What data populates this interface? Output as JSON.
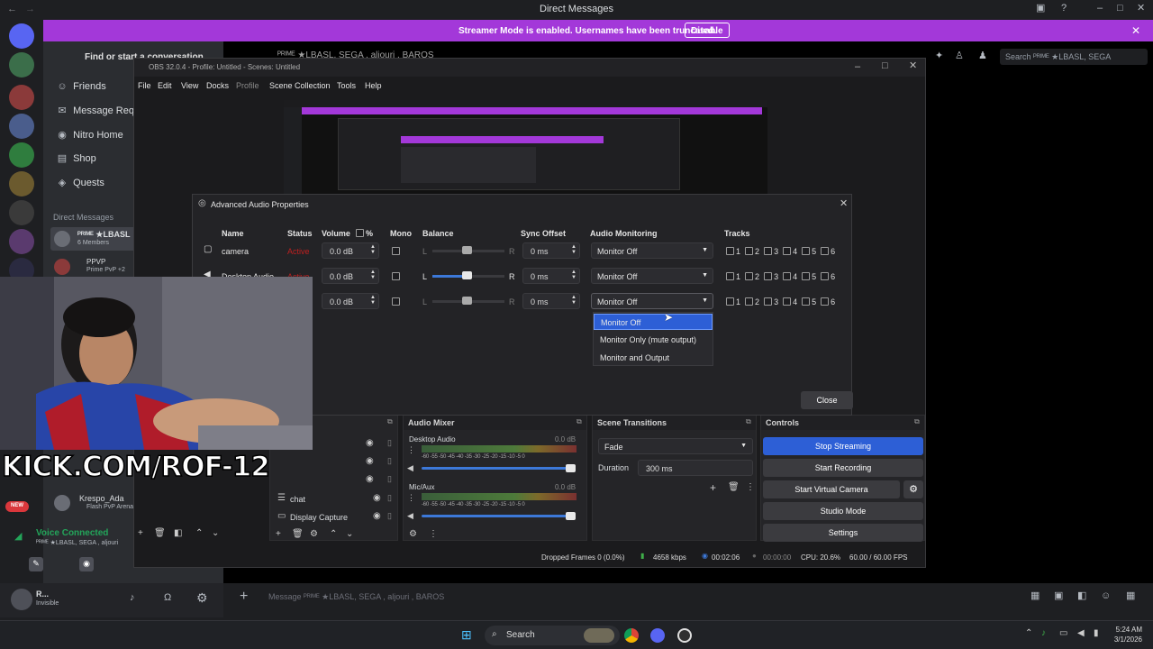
{
  "discord": {
    "window_title": "Direct Messages",
    "banner_text": "Streamer Mode is enabled. Usernames have been truncated.",
    "banner_button": "Disable",
    "find_placeholder": "Find or start a conversation",
    "nav": [
      "Friends",
      "Message Requests",
      "Nitro Home",
      "Shop",
      "Quests"
    ],
    "dm_header": "Direct Messages",
    "dm_items": [
      {
        "name": "ᴾᴿᴵᴹᴱ ★LBASL",
        "sub": "6 Members"
      },
      {
        "name": "PPVP",
        "sub": "Prime PvP +2"
      },
      {
        "name": "Krespo_Ada",
        "sub": "Flash PvP Arena"
      }
    ],
    "search_placeholder": "Search ᴾᴿᴵᴹᴱ ★LBASL, SEGA",
    "voice_status": "Voice Connected",
    "voice_channel": "ᴾᴿᴵᴹᴱ ★LBASL, SEGA , aljouri",
    "user_name": "R...",
    "user_status": "Invisible",
    "message_placeholder": "Message ᴾᴿᴵᴹᴱ ★LBASL, SEGA , aljouri , BAROS",
    "new_badge": "NEW",
    "channel_title": "ᴾᴿᴵᴹᴱ ★LBASL, SEGA , aljouri , BAROS"
  },
  "obs": {
    "title": "OBS 32.0.4 - Profile: Untitled - Scenes: Untitled",
    "menu": [
      "File",
      "Edit",
      "View",
      "Docks",
      "Profile",
      "Scene Collection",
      "Tools",
      "Help"
    ],
    "sources": [
      {
        "name": "chat"
      },
      {
        "name": "Display Capture"
      }
    ],
    "audio_mixer": {
      "title": "Audio Mixer",
      "channels": [
        {
          "name": "Desktop Audio",
          "db": "0.0 dB"
        },
        {
          "name": "Mic/Aux",
          "db": "0.0 dB"
        }
      ],
      "scale": "-60 -55 -50 -45 -40 -35 -30 -25 -20 -15 -10 -5 0"
    },
    "transitions": {
      "title": "Scene Transitions",
      "type": "Fade",
      "duration_label": "Duration",
      "duration": "300 ms"
    },
    "controls": {
      "title": "Controls",
      "buttons": [
        "Stop Streaming",
        "Start Recording",
        "Start Virtual Camera",
        "Studio Mode",
        "Settings"
      ]
    },
    "status": {
      "dropped": "Dropped Frames 0 (0.0%)",
      "kbps": "4658 kbps",
      "live_time": "00:02:06",
      "rec_time": "00:00:00",
      "cpu": "CPU: 20.6%",
      "fps": "60.00 / 60.00 FPS"
    }
  },
  "dialog": {
    "title": "Advanced Audio Properties",
    "headers": {
      "name": "Name",
      "status": "Status",
      "volume": "Volume",
      "percent": "%",
      "mono": "Mono",
      "balance": "Balance",
      "sync": "Sync Offset",
      "monitoring": "Audio Monitoring",
      "tracks": "Tracks"
    },
    "rows": [
      {
        "name": "camera",
        "status": "Active",
        "volume": "0.0 dB",
        "bal_l": "L",
        "bal_r": "R",
        "sync": "0 ms",
        "monitor": "Monitor Off"
      },
      {
        "name": "Desktop Audio",
        "status": "Active",
        "volume": "0.0 dB",
        "bal_l": "L",
        "bal_r": "R",
        "sync": "0 ms",
        "monitor": "Monitor Off"
      },
      {
        "name": "",
        "status": "",
        "volume": "0.0 dB",
        "bal_l": "L",
        "bal_r": "R",
        "sync": "0 ms",
        "monitor": "Monitor Off"
      }
    ],
    "track_labels": [
      "1",
      "2",
      "3",
      "4",
      "5",
      "6"
    ],
    "dropdown_options": [
      "Monitor Off",
      "Monitor Only (mute output)",
      "Monitor and Output"
    ],
    "close_label": "Close"
  },
  "overlay": {
    "kick": "KICK.COM/ROF-12"
  },
  "taskbar": {
    "search": "Search",
    "time": "5:24 AM",
    "date": "3/1/2026"
  },
  "colors": {
    "accent": "#3c78d8",
    "banner": "#a338d9",
    "stop_stream": "#2d5fd6",
    "discord_blurple": "#5865f2"
  }
}
